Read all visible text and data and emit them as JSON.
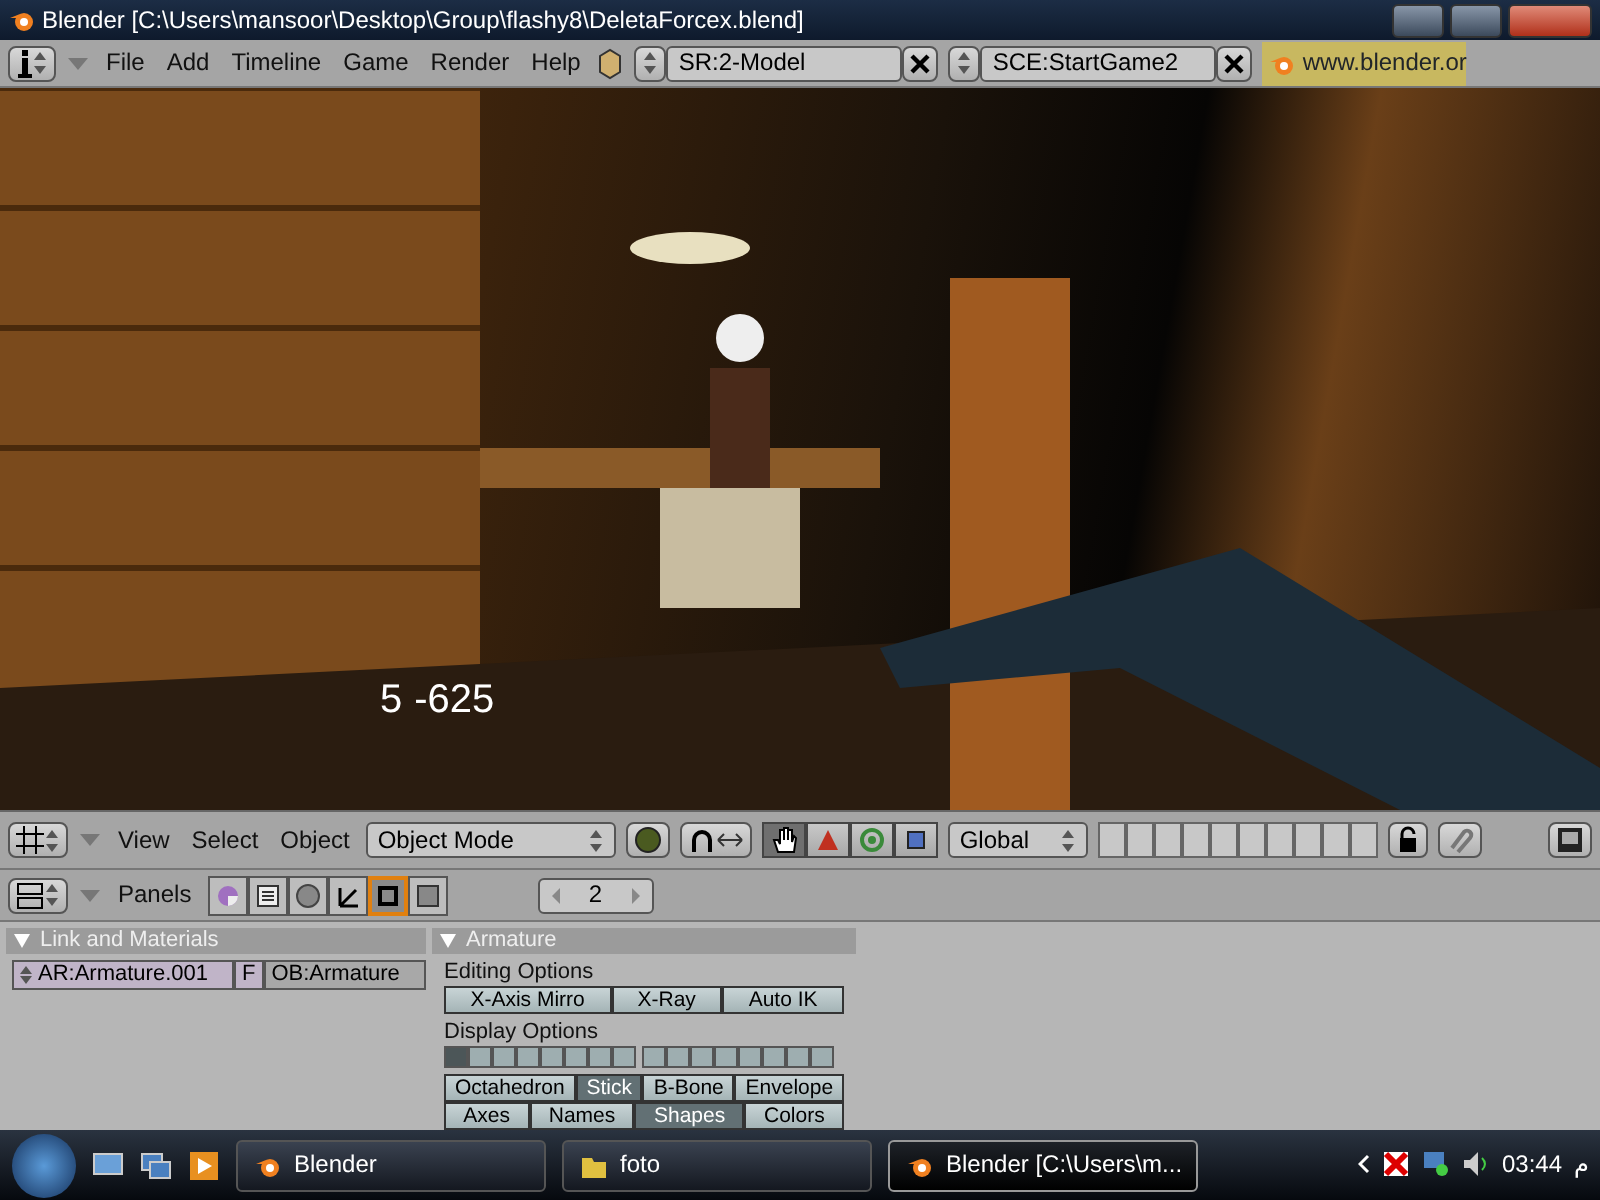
{
  "window": {
    "title": "Blender [C:\\Users\\mansoor\\Desktop\\Group\\flashy8\\DeletaForcex.blend]"
  },
  "menu_bar": {
    "menus": [
      "File",
      "Add",
      "Timeline",
      "Game",
      "Render",
      "Help"
    ],
    "screen": "SR:2-Model",
    "scene": "SCE:StartGame2",
    "url": "www.blender.or"
  },
  "viewport": {
    "hud_count": "5",
    "hud_score": "-625"
  },
  "view3d_header": {
    "menus": [
      "View",
      "Select",
      "Object"
    ],
    "mode": "Object Mode",
    "orientation": "Global",
    "manipulators": [
      {
        "kind": "hand",
        "selected": true
      },
      {
        "kind": "translate",
        "selected": false
      },
      {
        "kind": "rotate",
        "selected": false
      },
      {
        "kind": "scale",
        "selected": false
      }
    ]
  },
  "buttons_header": {
    "label": "Panels",
    "page": "2",
    "contexts": [
      {
        "kind": "logic",
        "selected": false
      },
      {
        "kind": "script",
        "selected": false
      },
      {
        "kind": "shading",
        "selected": false
      },
      {
        "kind": "object",
        "selected": false
      },
      {
        "kind": "editing",
        "selected": true
      },
      {
        "kind": "scene",
        "selected": false
      }
    ]
  },
  "link_panel": {
    "title": "Link and Materials",
    "armature": "AR:Armature.001",
    "fake": "F",
    "object": "OB:Armature"
  },
  "armature_panel": {
    "title": "Armature",
    "editing_label": "Editing Options",
    "editing": [
      {
        "label": "X-Axis Mirro",
        "selected": false
      },
      {
        "label": "X-Ray",
        "selected": false
      },
      {
        "label": "Auto IK",
        "selected": false
      }
    ],
    "display_label": "Display Options",
    "layers": [
      {
        "selected": true
      },
      {
        "selected": false
      },
      {
        "selected": false
      },
      {
        "selected": false
      },
      {
        "selected": false
      },
      {
        "selected": false
      },
      {
        "selected": false
      },
      {
        "selected": false
      },
      {
        "selected": false
      },
      {
        "selected": false
      },
      {
        "selected": false
      },
      {
        "selected": false
      },
      {
        "selected": false
      },
      {
        "selected": false
      },
      {
        "selected": false
      },
      {
        "selected": false
      }
    ],
    "draw_types": [
      {
        "label": "Octahedron",
        "selected": false
      },
      {
        "label": "Stick",
        "selected": true
      },
      {
        "label": "B-Bone",
        "selected": false
      },
      {
        "label": "Envelope",
        "selected": false
      }
    ],
    "draw_flags": [
      {
        "label": "Axes",
        "selected": false
      },
      {
        "label": "Names",
        "selected": false
      },
      {
        "label": "Shapes",
        "selected": true
      },
      {
        "label": "Colors",
        "selected": false
      }
    ]
  },
  "taskbar": {
    "tasks": [
      {
        "label": "Blender",
        "kind": "blender",
        "selected": false
      },
      {
        "label": "foto",
        "kind": "folder",
        "selected": false
      },
      {
        "label": "Blender [C:\\Users\\m...",
        "kind": "blender",
        "selected": true
      }
    ],
    "am_pm": "م",
    "time": "03:44"
  }
}
